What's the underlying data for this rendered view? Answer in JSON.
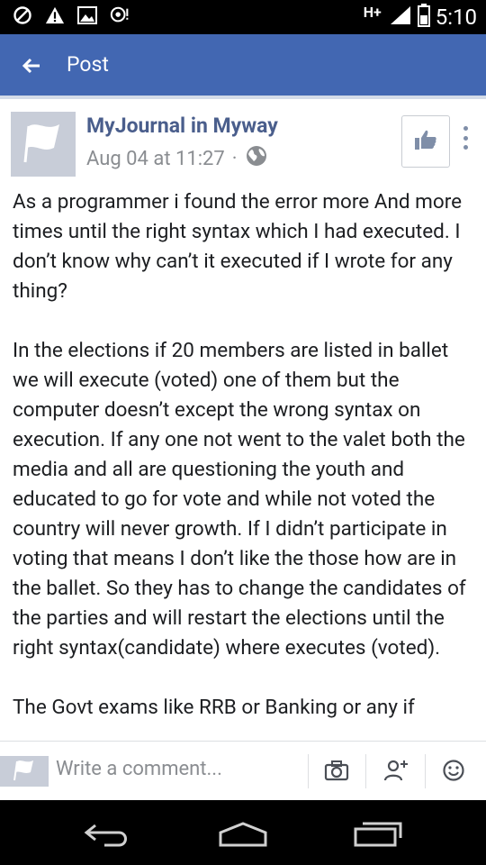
{
  "status_bar": {
    "icons": [
      "blocked-icon",
      "warning-icon",
      "image-icon",
      "chat-alert-icon"
    ],
    "network": "H+",
    "time": "5:10"
  },
  "app_bar": {
    "title": "Post"
  },
  "post": {
    "author": "MyJournal in Myway",
    "timestamp": "Aug 04 at 11:27",
    "separator": "·",
    "privacy_icon": "globe-icon",
    "paragraphs": [
      "As a programmer i found the error more And more times until the right syntax which I had executed. I don’t know why can’t it executed if I wrote for any thing?",
      "In the elections if 20 members are listed in ballet we will execute (voted) one of them but the computer doesn’t except the wrong syntax on execution. If any one not went to the valet both the media and all are questioning the youth and educated to go for vote and while not voted the country will never growth. If I didn’t participate in voting that means I don’t like the those how are in the ballet. So they has to change the candidates of the parties and will restart the elections until the right syntax(candidate) where executes (voted).",
      "The Govt exams like RRB or Banking or any if"
    ]
  },
  "composer": {
    "placeholder": "Write a comment..."
  }
}
